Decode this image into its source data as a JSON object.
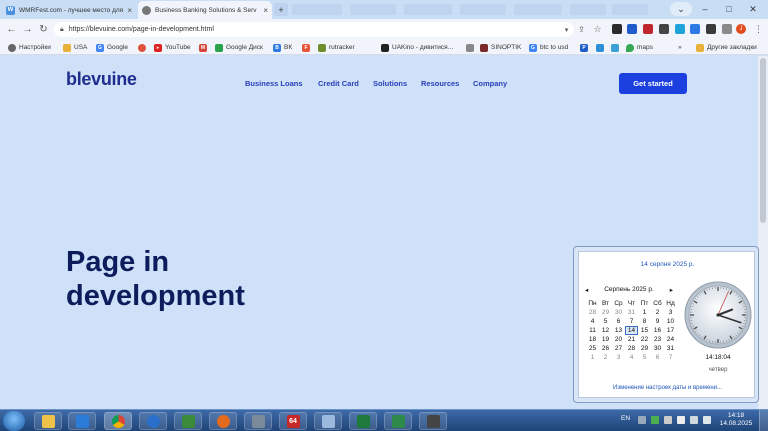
{
  "browser": {
    "tabs": [
      {
        "title": "WMRFest.com - лучшее место для",
        "close": "×"
      },
      {
        "title": "Business Banking Solutions & Serv",
        "close": "×"
      }
    ],
    "new_tab": "+",
    "url": "https://blevuine.com/page-in-development.html",
    "bookmarks": [
      "Настройки",
      "USA",
      "Google",
      "YouTube",
      "Google Диск",
      "ВК",
      "rutracker",
      "UAKino - дивитися...",
      "SINOPTIK",
      "btc to usd",
      "maps",
      "Другие закладки"
    ],
    "more": "»",
    "profile_initial": "J"
  },
  "site": {
    "logo": "blevuine",
    "nav": [
      "Business Loans",
      "Credit Card",
      "Solutions",
      "Resources",
      "Company"
    ],
    "cta": "Get started",
    "hero": "Page in development"
  },
  "calendar": {
    "long_date": "14 серпня 2025 р.",
    "month_label": "Серпень 2025 р.",
    "prev": "◂",
    "next": "▸",
    "weekdays": [
      "Пн",
      "Вт",
      "Ср",
      "Чт",
      "Пт",
      "Сб",
      "Нд"
    ],
    "weeks": [
      [
        "28",
        "29",
        "30",
        "31",
        "1",
        "2",
        "3"
      ],
      [
        "4",
        "5",
        "6",
        "7",
        "8",
        "9",
        "10"
      ],
      [
        "11",
        "12",
        "13",
        "14",
        "15",
        "16",
        "17"
      ],
      [
        "18",
        "19",
        "20",
        "21",
        "22",
        "23",
        "24"
      ],
      [
        "25",
        "26",
        "27",
        "28",
        "29",
        "30",
        "31"
      ],
      [
        "1",
        "2",
        "3",
        "4",
        "5",
        "6",
        "7"
      ]
    ],
    "clock_time": "14:18:04",
    "weekday_name": "четвер",
    "settings_link": "Изменение настроек даты и времени..."
  },
  "taskbar": {
    "lang": "EN",
    "time": "14:18",
    "date": "14.08.2025",
    "app_badge": "64"
  },
  "colors": {
    "page_bg": "#cfe1f9",
    "brand": "#1f2d8f",
    "nav_link": "#2740b9",
    "cta_bg": "#1c3fe0",
    "hero_text": "#0f1c5c"
  }
}
